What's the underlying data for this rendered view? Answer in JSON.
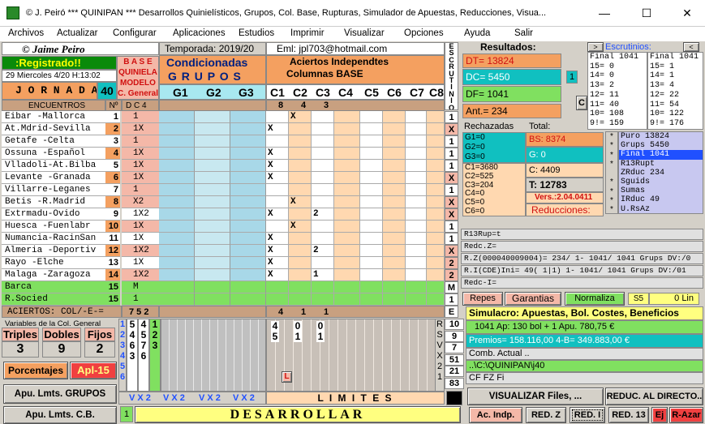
{
  "window": {
    "title": "©  J. Peiró   *** QUINIPAN ***   Desarrollos Quinielísticos, Grupos, Col. Base, Rupturas, Simulador de Apuestas,  Reducciones, Visua...",
    "min": "—",
    "max": "☐",
    "close": "✕"
  },
  "menu": [
    "Archivos",
    "Actualizar",
    "Configurar",
    "Aplicaciones",
    "Estudios",
    "Imprimir",
    "Visualizar",
    "Opciones",
    "Ayuda",
    "Salir"
  ],
  "header": {
    "author": "© Jaime Peiro",
    "season": "Temporada: 2019/20",
    "email": "Eml: jpl703@hotmail.com",
    "registered": ":Registrado!!",
    "date": "29 Miercoles 4/20  H:13:02",
    "jornada_label": "J O R N A D A",
    "jornada": "40",
    "base_lines": [
      "B A S E",
      "QUINIELA",
      "MODELO",
      "C. General"
    ],
    "cond_title": "Condicionadas",
    "grupos_title": "G R U P O S",
    "groups": [
      "G1",
      "G2",
      "G3"
    ],
    "aciertos_title": "Aciertos Independtes",
    "columnas_title": "Columnas BASE",
    "columns": [
      "C1",
      "C2",
      "C3",
      "C4",
      "C5",
      "C6",
      "C7",
      "C8"
    ],
    "escrutinio_letters": [
      "E",
      "S",
      "C",
      "R",
      "U",
      "T",
      "I",
      "N",
      "I",
      "O"
    ]
  },
  "table": {
    "head_encuentros": "ENCUENTROS",
    "head_no": "Nº",
    "head_dc4": "D C 4",
    "colhead_values": [
      "8",
      "4",
      "3"
    ],
    "rows": [
      {
        "team": "Eibar   -Mallorca",
        "n": "1",
        "sign": "1",
        "c": [
          "",
          "X",
          "",
          "",
          "",
          "",
          "",
          ""
        ],
        "escr": "1"
      },
      {
        "team": "At.Mdrid-Sevilla",
        "n": "2",
        "sign": "1X",
        "c": [
          "X",
          "",
          "",
          "",
          "",
          "",
          "",
          ""
        ],
        "escr": "X"
      },
      {
        "team": "  Getafe  -Celta",
        "n": "3",
        "sign": "1",
        "c": [
          "",
          "",
          "",
          "",
          "",
          "",
          "",
          ""
        ],
        "escr": "1"
      },
      {
        "team": "Ossuna  -Español",
        "n": "4",
        "sign": "1X",
        "c": [
          "X",
          "",
          "",
          "",
          "",
          "",
          "",
          ""
        ],
        "escr": "1"
      },
      {
        "team": "Vlladoli-At.Bilba",
        "n": "5",
        "sign": "1X",
        "c": [
          "X",
          "",
          "",
          "",
          "",
          "",
          "",
          ""
        ],
        "escr": "1"
      },
      {
        "team": "Levante  -Granada",
        "n": "6",
        "sign": "1X",
        "c": [
          "X",
          "",
          "",
          "",
          "",
          "",
          "",
          ""
        ],
        "escr": "X"
      },
      {
        "team": " Villarre-Leganes",
        "n": "7",
        "sign": "1",
        "c": [
          "",
          "",
          "",
          "",
          "",
          "",
          "",
          ""
        ],
        "escr": "1"
      },
      {
        "team": "Betis   -R.Madrid",
        "n": "8",
        "sign": "X2",
        "c": [
          "",
          "X",
          "",
          "",
          "",
          "",
          "",
          ""
        ],
        "escr": "X"
      },
      {
        "team": "  Extrmadu-Ovido",
        "n": "9",
        "sign": "1X2",
        "c": [
          "X",
          "",
          "2",
          "",
          "",
          "",
          "",
          ""
        ],
        "escr": "X"
      },
      {
        "team": "Huesca  -Fuenlabr",
        "n": "10",
        "sign": "1X",
        "c": [
          "",
          "X",
          "",
          "",
          "",
          "",
          "",
          ""
        ],
        "escr": "1"
      },
      {
        "team": "Numancia-RacinSan",
        "n": "11",
        "sign": "1X",
        "c": [
          "X",
          "",
          "",
          "",
          "",
          "",
          "",
          ""
        ],
        "escr": "1"
      },
      {
        "team": "Almeria -Deportiv",
        "n": "12",
        "sign": "1X2",
        "c": [
          "X",
          "",
          "2",
          "",
          "",
          "",
          "",
          ""
        ],
        "escr": "X"
      },
      {
        "team": "  Rayo    -Elche",
        "n": "13",
        "sign": "1X",
        "c": [
          "X",
          "",
          "",
          "",
          "",
          "",
          "",
          ""
        ],
        "escr": "2"
      },
      {
        "team": "Malaga  -Zaragoza",
        "n": "14",
        "sign": "1X2",
        "c": [
          "X",
          "",
          "1",
          "",
          "",
          "",
          "",
          ""
        ],
        "escr": "2"
      },
      {
        "team": "     Barca",
        "n": "15",
        "sign": " M",
        "c": [
          "",
          "",
          "",
          "",
          "",
          "",
          "",
          ""
        ],
        "escr": "M"
      },
      {
        "team": "     R.Socied",
        "n": "15",
        "sign": " 1",
        "c": [
          "",
          "",
          "",
          "",
          "",
          "",
          "",
          ""
        ],
        "escr": "1"
      }
    ],
    "aciertos_label": "ACIERTOS: COL/-E-=",
    "aciertos_signs": "7 5 2",
    "aciertos_values": [
      "4",
      "1",
      "1"
    ],
    "aciertos_escr": "E"
  },
  "results": {
    "title": "Resultados:",
    "dt": "DT=  13824",
    "dc": "DC=  5450",
    "dc_badge": "1",
    "df": "DF=  1041",
    "ant": "Ant.=  234",
    "c_badge": "C",
    "rechazadas": "Rechazadas",
    "total": "Total:",
    "g_list": [
      "G1=0",
      "G2=0",
      "G3=0"
    ],
    "c_list": [
      "C1=3680",
      "C2=525",
      "C3=204",
      "C4=0",
      "C5=0",
      "C6=0"
    ],
    "bs": "BS:   8374",
    "g0": "G:  0",
    "c_total": "C:  4409",
    "t_total": "T: 12783",
    "version": "Vers.:2.04.0411",
    "reducciones": "Reducciones:"
  },
  "escrutinios": {
    "label": "Escrutinios:",
    "left": [
      "Final 1041",
      "15= 0",
      "14= 0",
      "13= 2",
      "12= 11",
      "11= 40",
      "10= 108",
      "9!= 159"
    ],
    "right": [
      "Final 1041",
      "15= 1",
      "14= 1",
      "13= 4",
      "12= 22",
      "11= 54",
      "10= 122",
      "9!= 176"
    ],
    "list": [
      "Puro 13824",
      "Grups 5450",
      "Final 1041",
      "R13Rupt",
      "ZRduc 234",
      "Sguids",
      "Sumas",
      "IRduc 49",
      "U.RsAz"
    ],
    "selected_index": 2
  },
  "status_lines": [
    "R13Rup=t",
    "Redc.Z=",
    "R.Z(000040009004)= 234/ 1- 1041/ 1041 Grups DV:/0",
    "R.I(CDE)Ini= 49( 1|1) 1- 1041/ 1041 Grups DV:/01",
    "Redc-I="
  ],
  "simulacro": {
    "repes": "Repes",
    "garantias": "Garantias",
    "normaliza": "Normaliza",
    "s5": "S5",
    "lin": "0 Lin",
    "title": "Simulacro: Apuestas, Bol. Costes, Beneficios",
    "line1": "1041 Ap:  130 bol +  1 Apu. 780,75 €",
    "line2": "Premios=  158.116,00   4-B= 349.883,00 €",
    "comb": "Comb. Actual ..",
    "path": "..\\C:\\QUINIPAN\\j40",
    "cf": "CF FZ Fi"
  },
  "bottom": {
    "variables_label": "Variables de la Col. General",
    "triples_label": "Triples",
    "dobles_label": "Dobles",
    "fijos_label": "Fijos",
    "triples": "3",
    "dobles": "9",
    "fijos": "2",
    "porcentajes": "Porcentajes",
    "apl": "Apl-15",
    "apu_grupos": "Apu. Lmts.  GRUPOS",
    "apu_cb": "Apu. Lmts.  C.B.",
    "blue_digits": [
      "1",
      "2",
      "3",
      "4",
      "5",
      "6"
    ],
    "col_vals": [
      [
        "5",
        "4",
        "6",
        "3"
      ],
      [
        "4",
        "5",
        "7",
        "6"
      ],
      [
        "1",
        "2",
        "3"
      ]
    ],
    "mid_vals": [
      [
        "4",
        "5"
      ],
      [
        "0",
        "1"
      ],
      [
        "0",
        "1"
      ]
    ],
    "l_badge": "L",
    "rsvx": [
      "R",
      "S",
      "V",
      "X",
      "2",
      "1"
    ],
    "counts": [
      "10",
      "9",
      "7",
      "51",
      "21",
      "83"
    ],
    "vx2": [
      "V X 2",
      "V X 2",
      "V X 2",
      "V X 2"
    ],
    "limites": "L I M I T E S",
    "desarrollar": "DESARROLLAR",
    "one_badge": "1",
    "visualizar": "VISUALIZAR  Files, ...",
    "reduc": "REDUC. AL DIRECTO..",
    "ac_indp": "Ac. Indp.",
    "red_z": "RED. Z",
    "red_i": "RED. I",
    "red_13": "RED. 13",
    "ej": "Ej",
    "r_azar": "R-Azar"
  },
  "colors": {
    "orange": "#f4a060",
    "salmon": "#f4b8a8",
    "teal": "#10c0c0",
    "green": "#80e060",
    "darkgreen": "#0a8a0a",
    "blue": "#2050ff",
    "yellow": "#ffff80",
    "peach": "#ffd8b0",
    "lightblue": "#a8d8e8",
    "lavender": "#c8c8f0",
    "red": "#f04040"
  }
}
